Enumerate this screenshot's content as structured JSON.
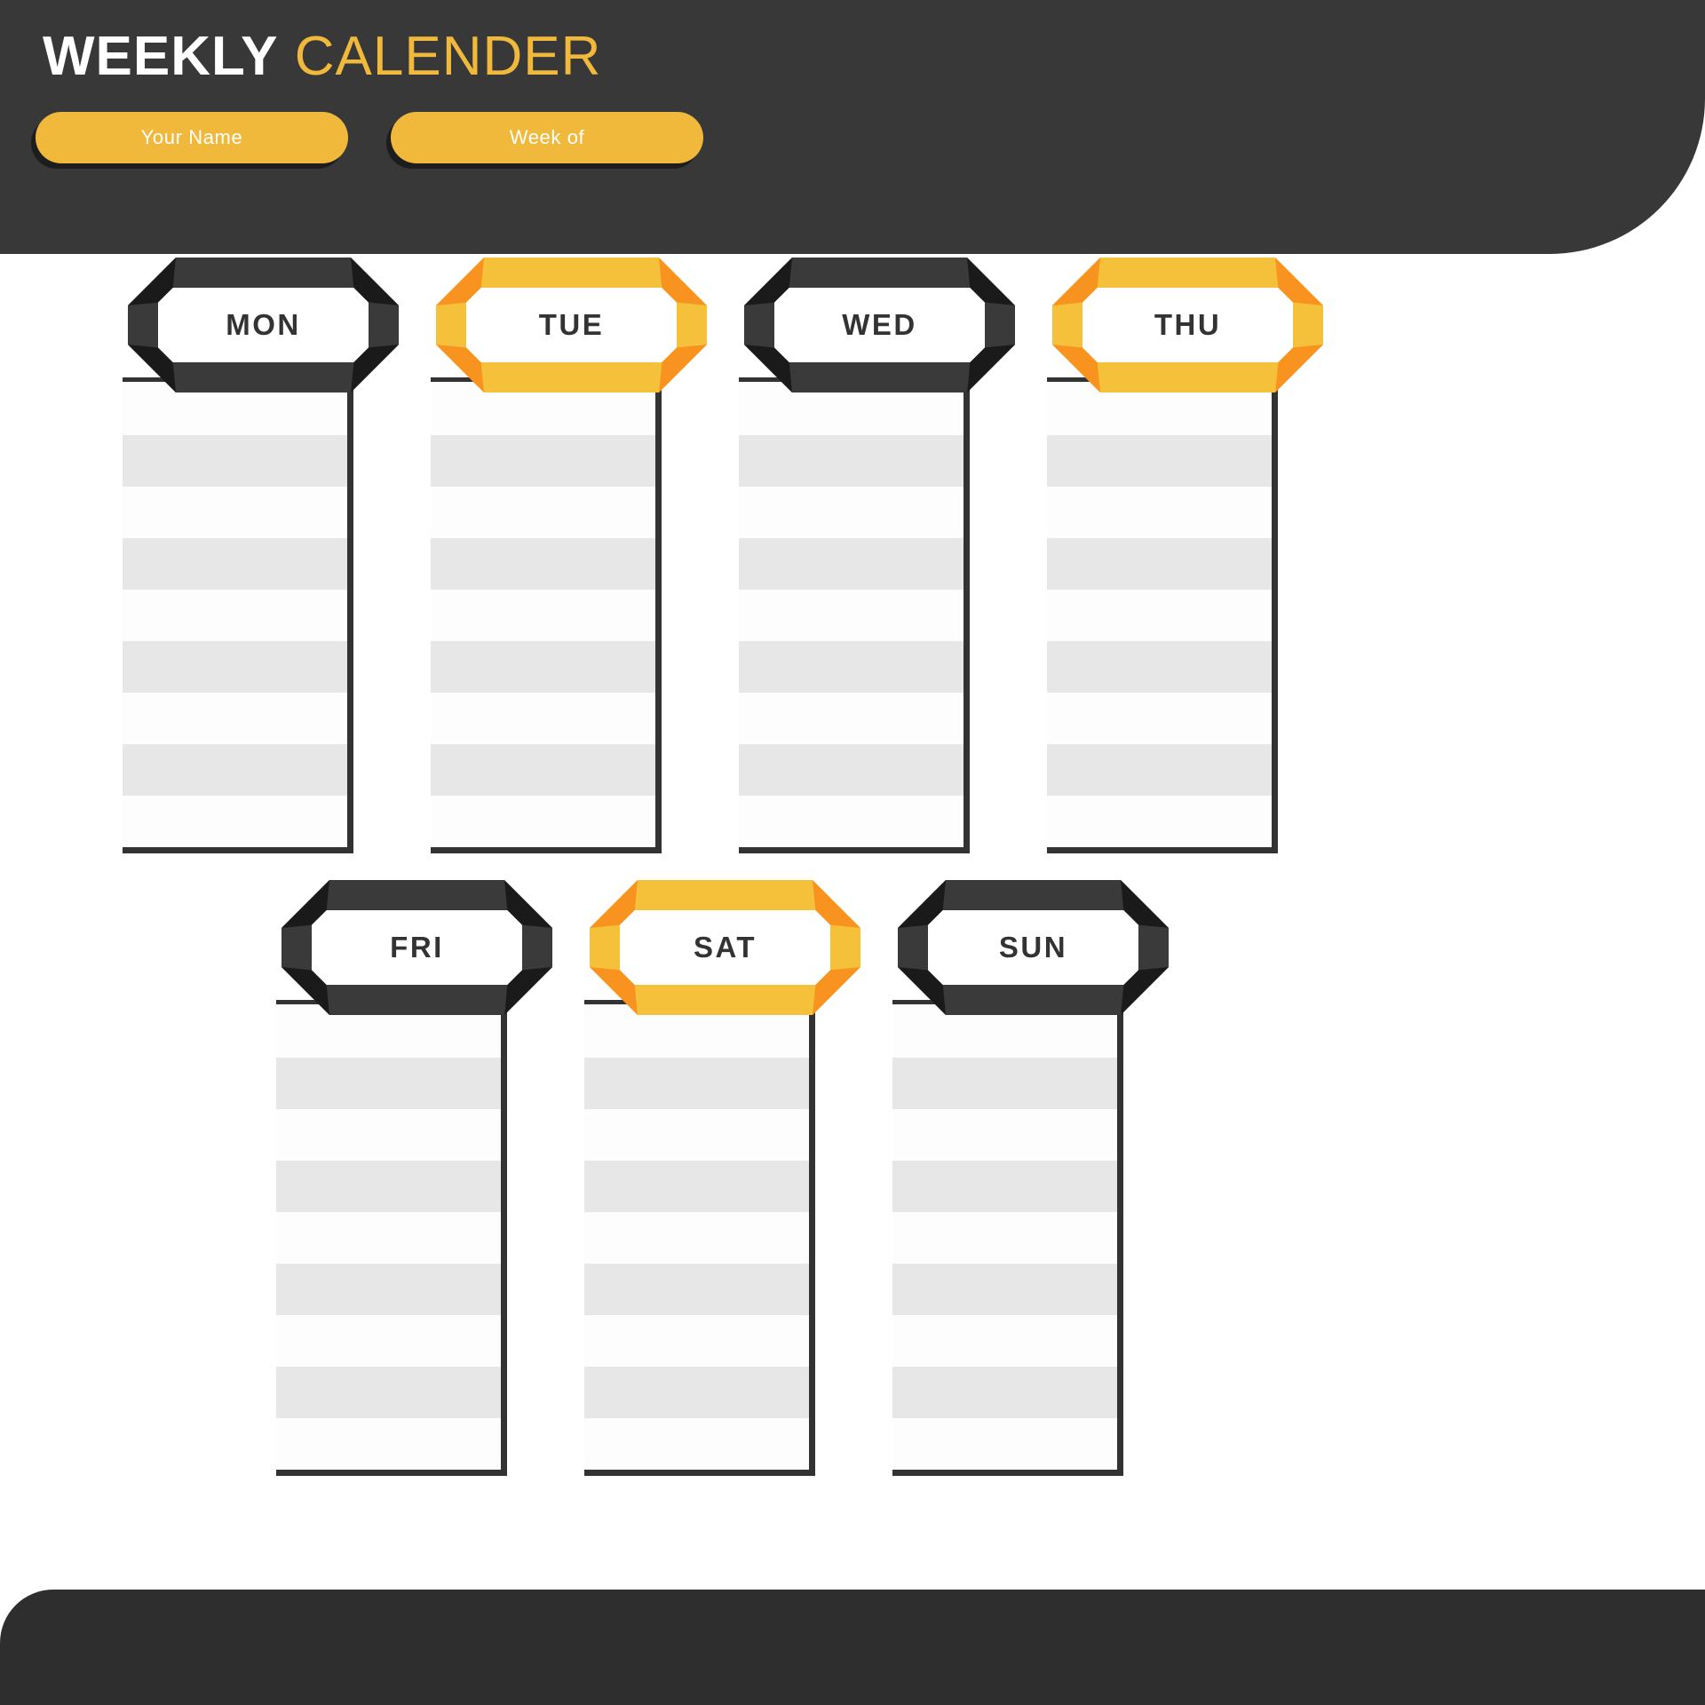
{
  "header": {
    "title_bold": "WEEKLY",
    "title_light": "CALENDER",
    "fields": [
      {
        "name": "your-name",
        "label": "Your Name"
      },
      {
        "name": "week-of",
        "label": "Week of"
      }
    ]
  },
  "colors": {
    "header_dark": "#383838",
    "footer_dark": "#2e2e2e",
    "accent_yellow": "#F0B93B",
    "badge_yellow_edge": "#F5C13A",
    "badge_orange_corner": "#F7931E",
    "badge_dark_edge": "#3a3a3a",
    "badge_dark_corner": "#1a1a1a",
    "stripe_gray": "#e7e7e7",
    "stripe_white": "#fdfdfd",
    "label_text": "#333333"
  },
  "days": [
    {
      "id": "mon",
      "label": "MON",
      "theme": "dark",
      "row": 1,
      "lines": 9
    },
    {
      "id": "tue",
      "label": "TUE",
      "theme": "yellow",
      "row": 1,
      "lines": 9
    },
    {
      "id": "wed",
      "label": "WED",
      "theme": "dark",
      "row": 1,
      "lines": 9
    },
    {
      "id": "thu",
      "label": "THU",
      "theme": "yellow",
      "row": 1,
      "lines": 9
    },
    {
      "id": "fri",
      "label": "FRI",
      "theme": "dark",
      "row": 2,
      "lines": 9
    },
    {
      "id": "sat",
      "label": "SAT",
      "theme": "yellow",
      "row": 2,
      "lines": 9
    },
    {
      "id": "sun",
      "label": "SUN",
      "theme": "dark",
      "row": 2,
      "lines": 9
    }
  ]
}
